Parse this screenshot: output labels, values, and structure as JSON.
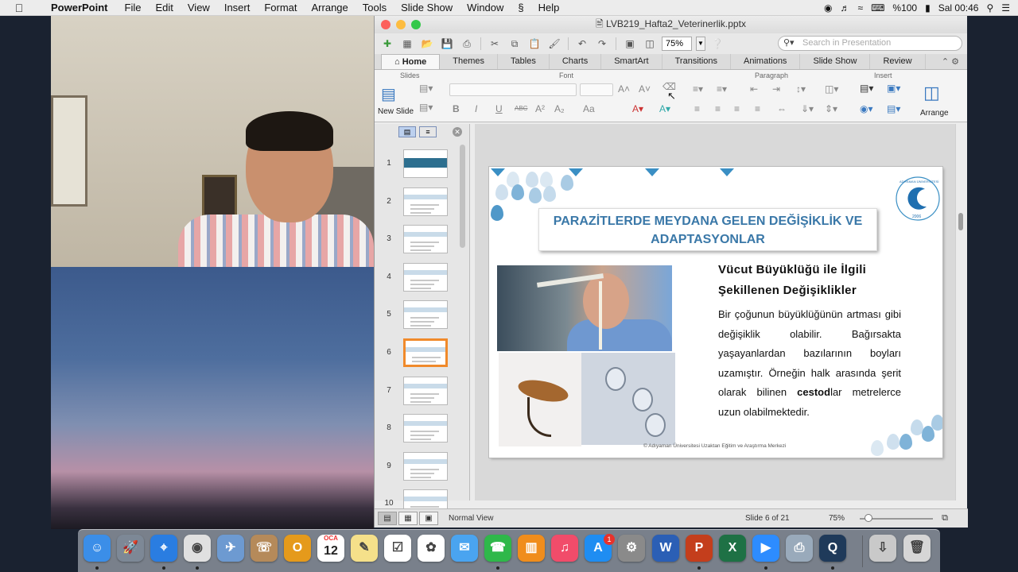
{
  "menubar": {
    "apple": "",
    "app_name": "PowerPoint",
    "items": [
      "File",
      "Edit",
      "View",
      "Insert",
      "Format",
      "Arrange",
      "Tools",
      "Slide Show",
      "Window",
      "Help"
    ],
    "status": {
      "battery": "%100",
      "clock": "Sal 00:46"
    }
  },
  "window": {
    "title": "LVB219_Hafta2_Veterinerlik.pptx",
    "zoom": "75%",
    "search_placeholder": "Search in Presentation"
  },
  "ribbon": {
    "tabs": [
      "Home",
      "Themes",
      "Tables",
      "Charts",
      "SmartArt",
      "Transitions",
      "Animations",
      "Slide Show",
      "Review"
    ],
    "active_tab": "Home",
    "groups": {
      "slides": "Slides",
      "font": "Font",
      "paragraph": "Paragraph",
      "insert": "Insert"
    },
    "new_slide_label": "New Slide",
    "arrange_label": "Arrange",
    "font_buttons": [
      "B",
      "I",
      "U",
      "ABC",
      "A²",
      "A₂",
      "Aa"
    ]
  },
  "thumbnails": {
    "numbers": [
      "1",
      "2",
      "3",
      "4",
      "5",
      "6",
      "7",
      "8",
      "9",
      "10"
    ],
    "active_index": 6
  },
  "slide": {
    "title": "PARAZİTLERDE MEYDANA GELEN DEĞİŞİKLİK VE ADAPTASYONLAR",
    "subheading": "Vücut Büyüklüğü ile İlgili Şekillenen Değişiklikler",
    "body_pre": "Bir çoğunun büyüklüğünün artması gibi değişiklik olabilir. Bağırsakta yaşayanlardan bazılarının boyları uzamıştır. Örneğin halk arasında şerit olarak bilinen ",
    "body_bold": "cestod",
    "body_post": "lar metrelerce uzun olabilmektedir.",
    "footer": "©  Adıyaman Üniversitesi Uzaktan Eğitim ve Araştırma Merkezi",
    "logo_text": "ADIYAMAN ÜNİVERSİTESİ",
    "logo_year": "2006"
  },
  "statusbar": {
    "view_label": "Normal View",
    "slide_position": "Slide 6 of 21",
    "zoom": "75%"
  },
  "dock": {
    "calendar_month": "OCA",
    "calendar_day": "12",
    "app_store_badge": "1",
    "apps": [
      "Finder",
      "Launchpad",
      "Safari",
      "Chrome",
      "Preview",
      "Contacts",
      "Outlook",
      "Calendar",
      "Notes",
      "Reminders",
      "Photos",
      "Messages",
      "FaceTime",
      "Books",
      "Music",
      "App Store",
      "System Preferences",
      "Word",
      "PowerPoint",
      "Excel",
      "Zoom",
      "Preview-Scan",
      "QuickTime",
      "Downloads",
      "Trash"
    ]
  }
}
